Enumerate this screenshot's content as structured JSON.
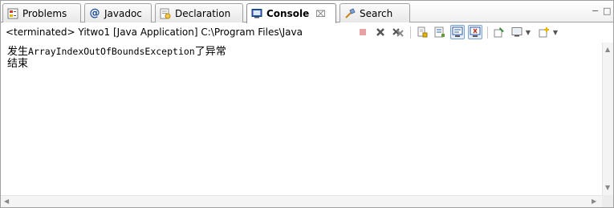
{
  "tabs": [
    {
      "label": "Problems",
      "icon": "problems-icon"
    },
    {
      "label": "Javadoc",
      "icon": "javadoc-icon"
    },
    {
      "label": "Declaration",
      "icon": "declaration-icon"
    },
    {
      "label": "Console",
      "icon": "console-icon",
      "active": true,
      "close": "⌧"
    },
    {
      "label": "Search",
      "icon": "search-icon"
    }
  ],
  "window_controls": {
    "minimize": "−",
    "maximize": "□"
  },
  "toolbar": {
    "status": "<terminated> Yitwo1 [Java Application] C:\\Program Files\\Java",
    "buttons": [
      "terminate-icon",
      "remove-launch-icon",
      "remove-all-terminated-icon",
      "scroll-lock-icon",
      "word-wrap-icon",
      "show-on-stdout-icon",
      "show-on-stderr-icon",
      "pin-console-icon",
      "display-console-icon",
      "open-console-icon"
    ]
  },
  "console": {
    "lines": [
      {
        "prefix": "发生",
        "mono": "ArrayIndexOutOfBoundsException",
        "suffix": "了异常"
      },
      {
        "prefix": "结束",
        "mono": "",
        "suffix": ""
      }
    ]
  },
  "colors": {
    "accent": "#2a5db0",
    "terminate_red": "#c0392b",
    "border": "#a0a0a0"
  }
}
